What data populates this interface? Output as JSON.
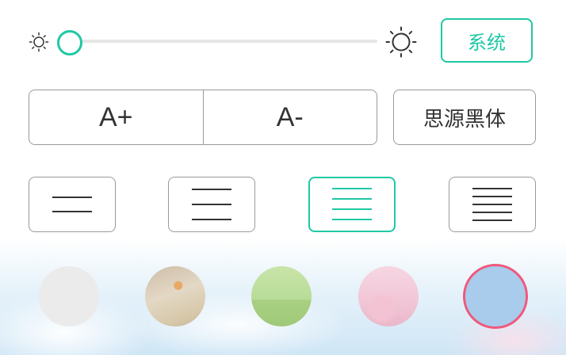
{
  "brightness": {
    "level": 0.0,
    "system_label": "系统",
    "icons": {
      "min": "sun-small-icon",
      "max": "sun-large-icon"
    }
  },
  "font": {
    "increase_label": "A+",
    "decrease_label": "A-",
    "typeface_label": "思源黑体"
  },
  "spacing": {
    "options": [
      "loose",
      "medium",
      "normal",
      "compact"
    ],
    "selected_index": 2
  },
  "themes": {
    "options": [
      "gray",
      "sunset",
      "green",
      "pink",
      "blue"
    ],
    "selected_index": 4
  },
  "colors": {
    "accent": "#1fc8a4",
    "selected_theme_border": "#f0587c",
    "border": "#9a9a9a",
    "text": "#333333"
  }
}
